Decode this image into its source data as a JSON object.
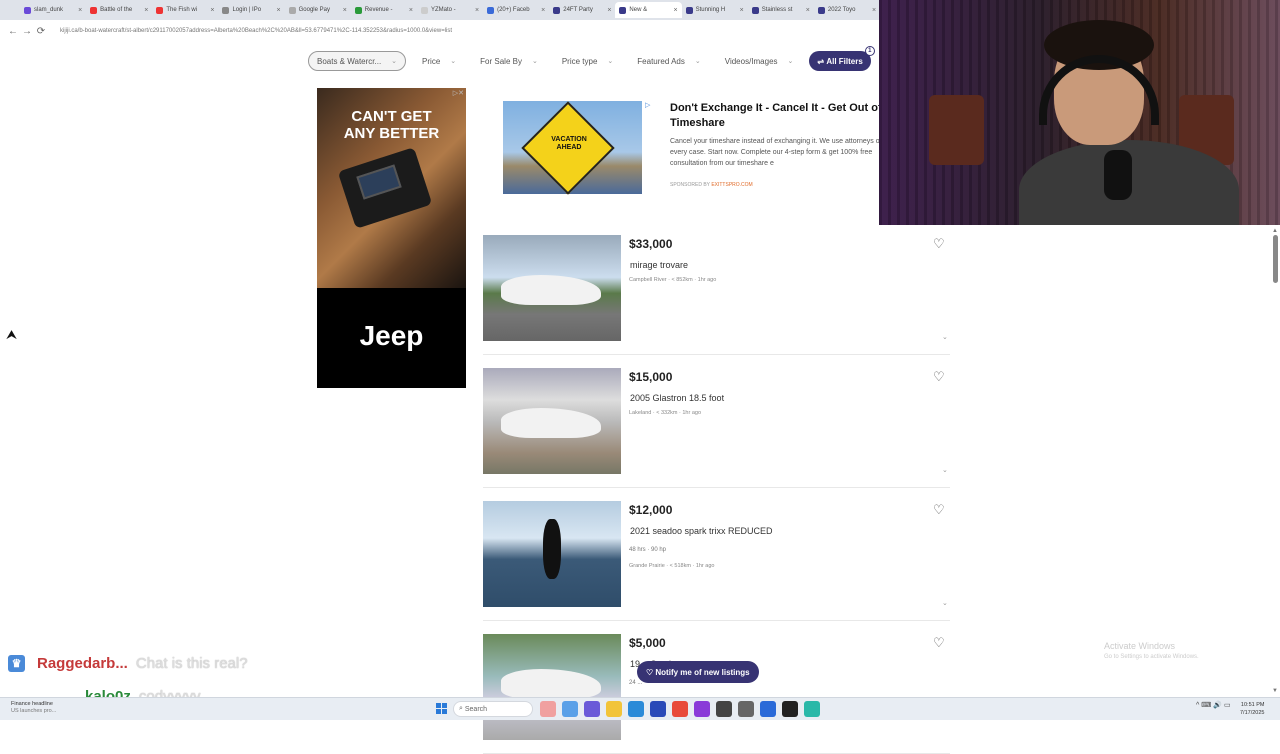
{
  "browser": {
    "tabs": [
      {
        "label": "slam_dunk",
        "color": "#6a4ad8"
      },
      {
        "label": "Battle of the",
        "color": "#e33"
      },
      {
        "label": "The Fish wi",
        "color": "#e33"
      },
      {
        "label": "Login | IPo",
        "color": "#888"
      },
      {
        "label": "Google Pay",
        "color": "#aaa"
      },
      {
        "label": "Revenue - ",
        "color": "#2a9a3a"
      },
      {
        "label": "YZMato - ",
        "color": "#ccc"
      },
      {
        "label": "(20+) Faceb",
        "color": "#3a6ad8"
      },
      {
        "label": "24FT Party ",
        "color": "#3a3a8a"
      },
      {
        "label": "New &",
        "color": "#3a3a8a",
        "active": true
      },
      {
        "label": "Stunning H",
        "color": "#3a3a8a"
      },
      {
        "label": "Stainless st",
        "color": "#3a3a8a"
      },
      {
        "label": "2022 Toyo",
        "color": "#3a3a8a"
      }
    ],
    "url": "kijiji.ca/b-boat-watercraft/st-albert/c29117002057address=Alberta%20Beach%2C%20AB&ll=53.6779471%2C-114.352253&radius=1000.0&view=list"
  },
  "filters": [
    {
      "label": "Boats & Watercr...",
      "outlined": true
    },
    {
      "label": "Price"
    },
    {
      "label": "For Sale By"
    },
    {
      "label": "Price type"
    },
    {
      "label": "Featured Ads"
    },
    {
      "label": "Videos/Images"
    }
  ],
  "all_filters": {
    "label": "All Filters",
    "count": "1"
  },
  "jeep_ad": {
    "headline_line1": "CAN'T GET",
    "headline_line2": "ANY BETTER",
    "brand": "Jeep"
  },
  "sponsored": {
    "image_text_line1": "VACATION",
    "image_text_line2": "AHEAD",
    "title": "Don't Exchange It - Cancel It - Get Out of Timeshare",
    "body": "Cancel your timeshare instead of exchanging it. We use attorneys on every case. Start now. Complete our 4-step form & get 100% free consultation from our timeshare e",
    "by_label": "SPONSORED BY",
    "by_brand": "EXITTSPRO.COM"
  },
  "listings": [
    {
      "price": "$33,000",
      "title": "mirage trovare",
      "attrs": "",
      "location": "Campbell River",
      "distance": "< 852km",
      "time": "1hr ago"
    },
    {
      "price": "$15,000",
      "title": "2005 Glastron 18.5 foot",
      "attrs": "",
      "location": "Lakeland",
      "distance": "< 332km",
      "time": "1hr ago"
    },
    {
      "price": "$12,000",
      "title": "2021 seadoo spark trixx REDUCED",
      "attrs": "48 hrs  ·  90 hp",
      "location": "Grande Prairie",
      "distance": "< 518km",
      "time": "1hr ago"
    },
    {
      "price": "$5,000",
      "title": "19... Crusier",
      "attrs": "24 ...",
      "location": "",
      "distance": "",
      "time": ""
    }
  ],
  "notify": {
    "label": "♡ Notify me of new listings"
  },
  "chat": [
    {
      "user": "Raggedarb...",
      "message": "Chat is this real?"
    },
    {
      "user": "kalo0z",
      "message": "codyyyyy"
    }
  ],
  "watermark": {
    "line1": "Activate Windows",
    "line2": "Go to Settings to activate Windows."
  },
  "taskbar": {
    "news_title": "Finance headline",
    "news_sub": "US launches pro...",
    "search_label": "Search",
    "clock_time": "10:51 PM",
    "clock_date": "7/17/2025"
  }
}
